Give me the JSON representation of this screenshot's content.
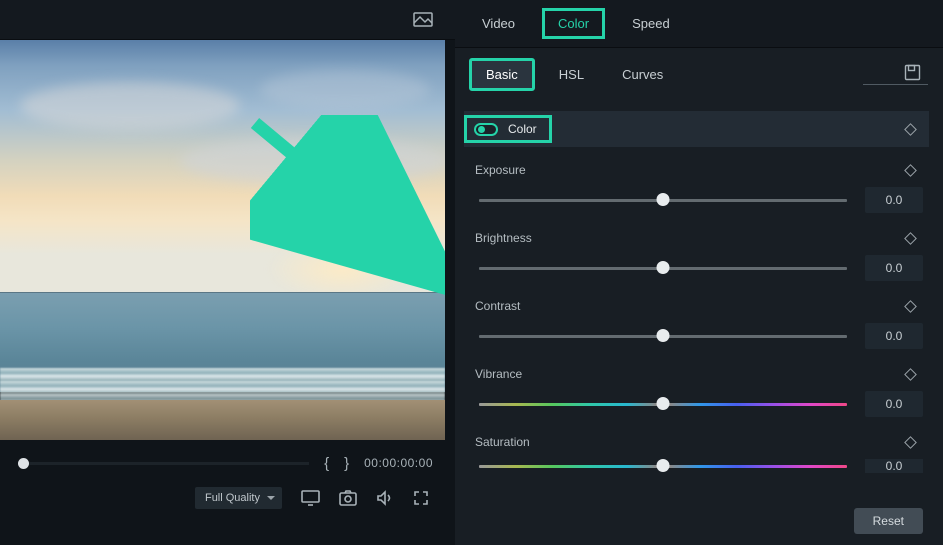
{
  "tabs": {
    "video": "Video",
    "color": "Color",
    "speed": "Speed"
  },
  "sub_tabs": {
    "basic": "Basic",
    "hsl": "HSL",
    "curves": "Curves"
  },
  "section": {
    "title": "Color"
  },
  "sliders": {
    "exposure": {
      "label": "Exposure",
      "value": "0.0",
      "pos": 50
    },
    "brightness": {
      "label": "Brightness",
      "value": "0.0",
      "pos": 50
    },
    "contrast": {
      "label": "Contrast",
      "value": "0.0",
      "pos": 50
    },
    "vibrance": {
      "label": "Vibrance",
      "value": "0.0",
      "pos": 50
    },
    "saturation": {
      "label": "Saturation",
      "value": "0.0",
      "pos": 50
    }
  },
  "footer": {
    "reset": "Reset"
  },
  "preview": {
    "timecode": "00:00:00:00",
    "quality": "Full Quality"
  }
}
